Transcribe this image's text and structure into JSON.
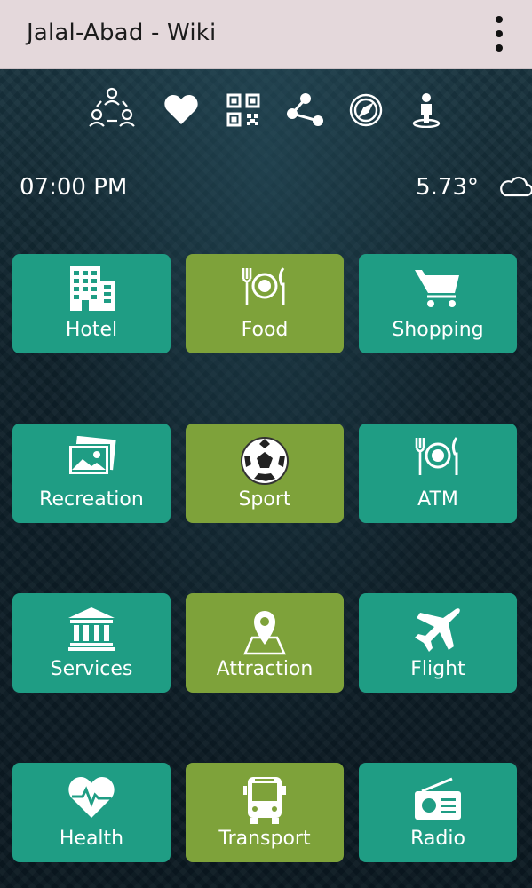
{
  "app": {
    "title": "Jalal-Abad - Wiki",
    "overflow_icon": "more-vert-icon"
  },
  "toolbar": {
    "icons": [
      "community-icon",
      "heart-icon",
      "qr-code-icon",
      "share-icon",
      "compass-icon",
      "person-location-icon"
    ]
  },
  "status": {
    "time": "07:00 PM",
    "temperature": "5.73°",
    "weather_icon": "cloud-icon"
  },
  "tiles": [
    {
      "label": "Hotel",
      "icon": "hotel-icon",
      "color": "#1f9d84"
    },
    {
      "label": "Food",
      "icon": "restaurant-icon",
      "color": "#7ea23a"
    },
    {
      "label": "Shopping",
      "icon": "cart-icon",
      "color": "#1f9d84"
    },
    {
      "label": "Recreation",
      "icon": "photos-icon",
      "color": "#1f9d84"
    },
    {
      "label": "Sport",
      "icon": "soccer-ball-icon",
      "color": "#7ea23a"
    },
    {
      "label": "ATM",
      "icon": "restaurant-icon",
      "color": "#1f9d84"
    },
    {
      "label": "Services",
      "icon": "bank-icon",
      "color": "#1f9d84"
    },
    {
      "label": "Attraction",
      "icon": "map-pin-icon",
      "color": "#7ea23a"
    },
    {
      "label": "Flight",
      "icon": "airplane-icon",
      "color": "#1f9d84"
    },
    {
      "label": "Health",
      "icon": "heart-pulse-icon",
      "color": "#1f9d84"
    },
    {
      "label": "Transport",
      "icon": "bus-icon",
      "color": "#7ea23a"
    },
    {
      "label": "Radio",
      "icon": "radio-icon",
      "color": "#1f9d84"
    }
  ],
  "colors": {
    "appbar": "#e4d8db",
    "tile_teal": "#1f9d84",
    "tile_olive": "#7ea23a",
    "background": "#0c1a24"
  }
}
